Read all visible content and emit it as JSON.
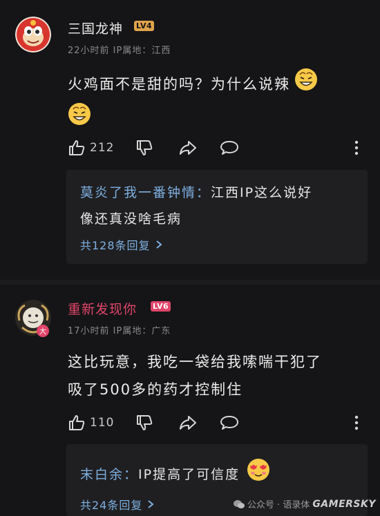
{
  "comments": [
    {
      "username": "三国龙神",
      "level": "LV4",
      "meta": "22小时前 IP属地：江西",
      "body_line1": "火鸡面不是甜的吗？为什么说辣",
      "likes": "212",
      "reply": {
        "user": "莫炎了我一番钟情：",
        "text_line1": "江西IP这么说好",
        "text_line2": "像还真没啥毛病",
        "more": "共128条回复"
      }
    },
    {
      "username": "重新发现你",
      "level": "LV6",
      "meta": "17小时前 IP属地：广东",
      "body_line1": "这比玩意，我吃一袋给我嗦喘干犯了",
      "body_line2": "吸了500多的药才控制住",
      "likes": "110",
      "reply": {
        "user": "末白余：",
        "text_line1": "IP提高了可信度",
        "more": "共24条回复"
      }
    }
  ],
  "watermark": {
    "wechat": "公众号 · 语录体",
    "site": "GAMERSKY"
  },
  "colors": {
    "background": "#151517",
    "reply_box": "#1f1f22",
    "link_blue": "#7fb0e0",
    "lv4_badge": "#e0a24a",
    "lv6_badge": "#e0456a",
    "vip_name": "#e0456a"
  }
}
